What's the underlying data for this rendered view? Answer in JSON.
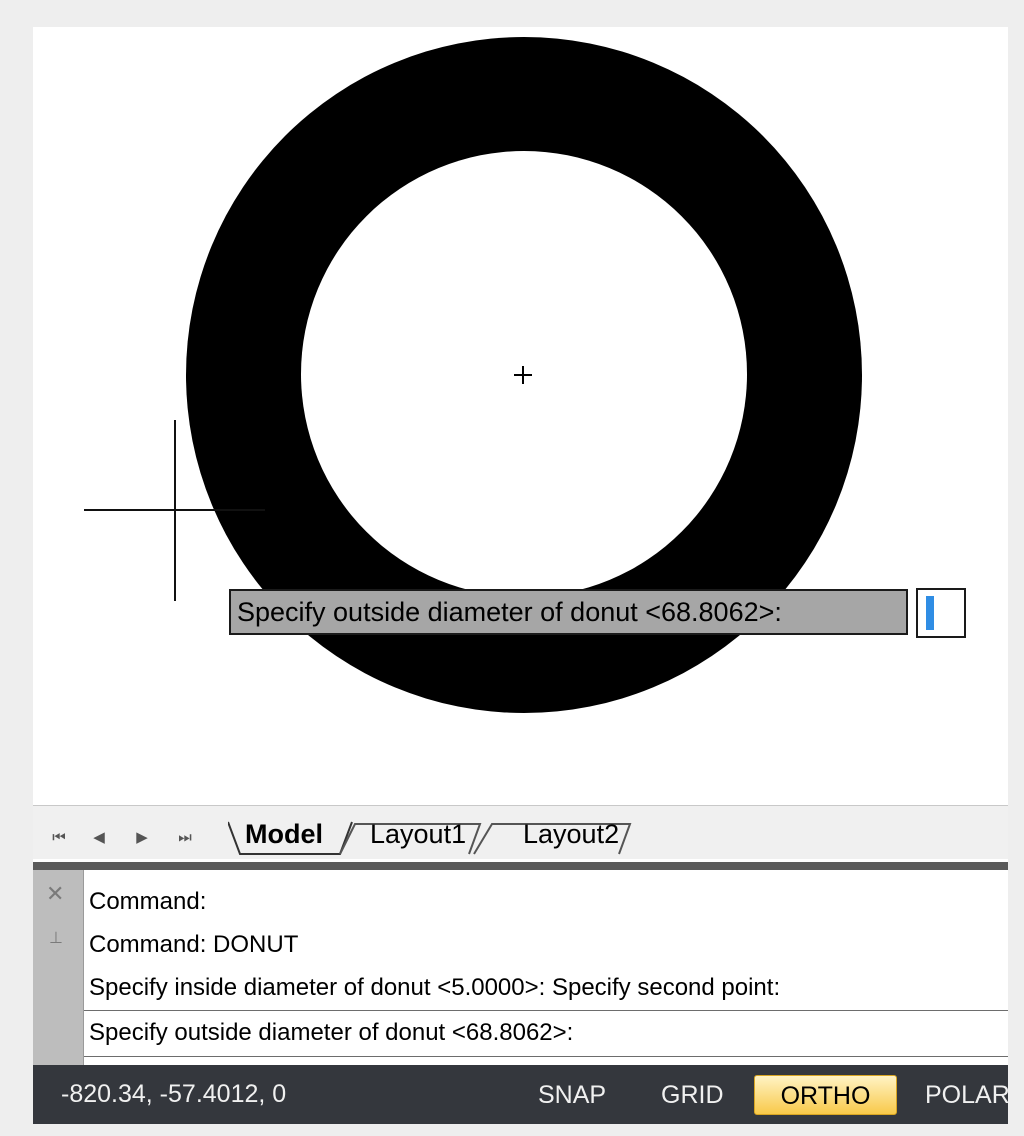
{
  "canvas": {
    "dynamic_prompt": "Specify outside diameter of donut <68.8062>:",
    "donut_color": "#000000",
    "crosshair_color": "#111111"
  },
  "layout_tabs": {
    "nav_buttons": [
      "first-tab",
      "previous-tab",
      "next-tab",
      "last-tab"
    ],
    "tabs": [
      {
        "label": "Model",
        "active": true
      },
      {
        "label": "Layout1",
        "active": false
      },
      {
        "label": "Layout2",
        "active": false
      }
    ]
  },
  "command_window": {
    "history": [
      "Command:",
      "Command: DONUT",
      "Specify inside diameter of donut <5.0000>:  Specify second point:"
    ],
    "current_prompt": "Specify outside diameter of donut <68.8062>:"
  },
  "status_bar": {
    "coordinates": "-820.34, -57.4012, 0",
    "buttons": [
      {
        "label": "SNAP",
        "active": false
      },
      {
        "label": "GRID",
        "active": false
      },
      {
        "label": "ORTHO",
        "active": true
      },
      {
        "label": "POLAR",
        "active": false
      }
    ],
    "background_color": "#34373d",
    "active_color": "#f8c94a"
  }
}
